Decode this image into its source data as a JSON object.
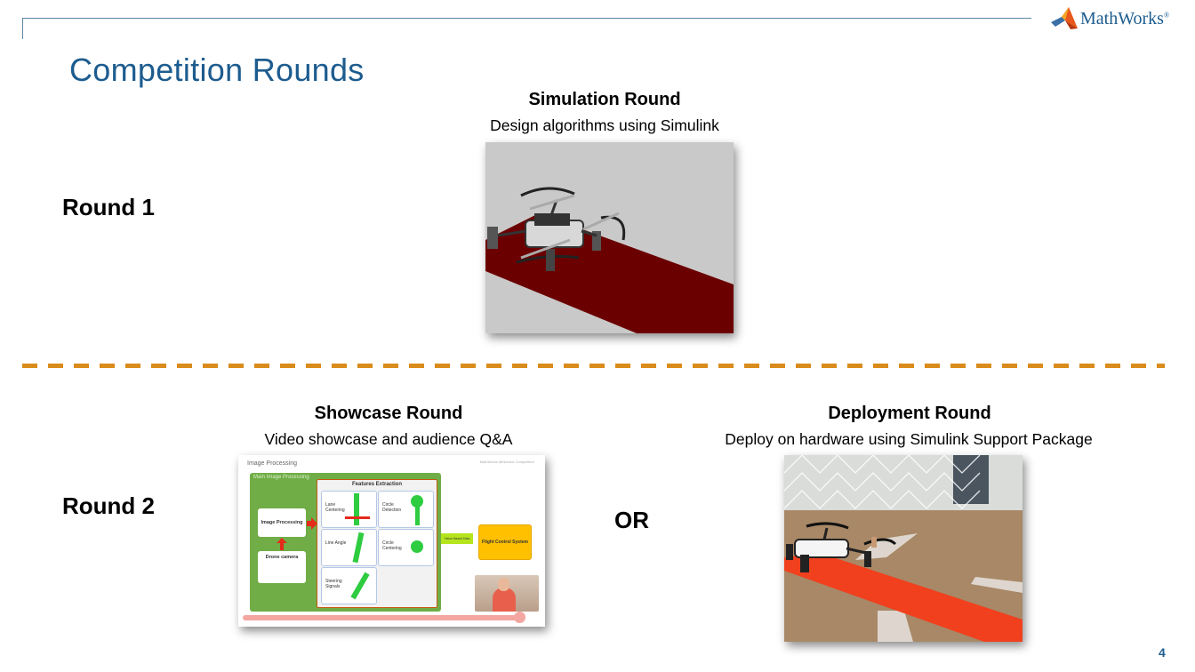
{
  "header": {
    "title": "Competition Rounds",
    "logo_text": "MathWorks",
    "logo_reg": "®",
    "page_number": "4"
  },
  "round1": {
    "label": "Round 1",
    "simulation": {
      "heading": "Simulation Round",
      "subtitle": "Design algorithms using Simulink",
      "image_desc": "simulated-drone-on-red-track"
    }
  },
  "round2": {
    "label": "Round 2",
    "separator": "OR",
    "showcase": {
      "heading": "Showcase Round",
      "subtitle": "Video showcase and audience Q&A",
      "slide": {
        "title": "Image Processing",
        "credit": "MathWorks Minidrone Competition",
        "main_label": "Main Image Processing",
        "image_processing": "Image Processing",
        "drone_camera": "Drone camera",
        "features_title": "Features Extraction",
        "features": [
          "Lane Centering",
          "Circle Detection",
          "Line Angle",
          "Circle Centering",
          "Steering Signals"
        ],
        "vision_label": "Vision Based Data",
        "flight_control": "Flight Control System"
      }
    },
    "deployment": {
      "heading": "Deployment Round",
      "subtitle": "Deploy on hardware using Simulink Support Package",
      "image_desc": "real-drone-on-red-track"
    }
  },
  "colors": {
    "title_blue": "#1d5c8f",
    "divider_orange": "#d98b1b",
    "track_red_sim": "#6b0000",
    "track_red_real": "#f0401e"
  }
}
